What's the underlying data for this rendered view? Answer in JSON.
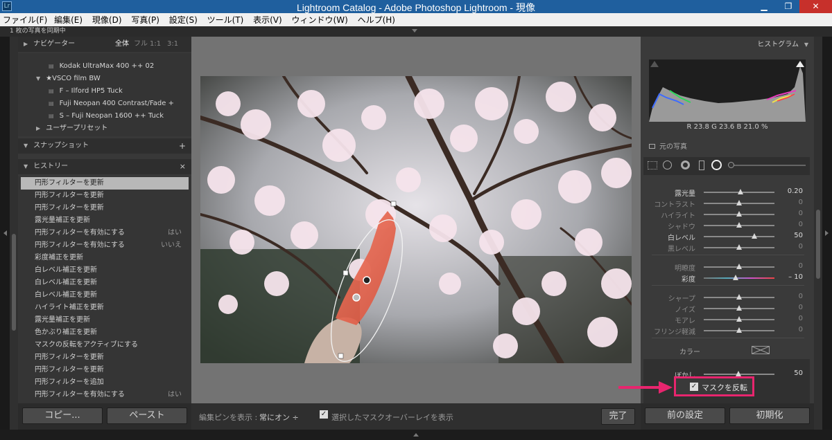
{
  "titlebar": {
    "title": "Lightroom Catalog - Adobe Photoshop Lightroom - 現像",
    "app_icon": "Lr",
    "minimize": "▁",
    "maximize": "❐",
    "close": "✕"
  },
  "menubar": {
    "items": [
      "ファイル(F)",
      "編集(E)",
      "現像(D)",
      "写真(P)",
      "設定(S)",
      "ツール(T)",
      "表示(V)",
      "ウィンドウ(W)",
      "ヘルプ(H)"
    ]
  },
  "status": "1 枚の写真を同期中",
  "navigator": {
    "title": "ナビゲーター",
    "zoom_options": [
      "全体",
      "フル",
      "1:1",
      "3:1"
    ]
  },
  "presets": {
    "items": [
      {
        "label": "Kodak UltraMax 400 ++ 02"
      },
      {
        "label": "★VSCO film BW"
      },
      {
        "label": "F – Ilford HP5 Tuck"
      },
      {
        "label": "Fuji Neopan 400 Contrast/Fade +"
      },
      {
        "label": "S – Fuji Neopan 1600 ++ Tuck"
      },
      {
        "label": "ユーザープリセット"
      }
    ]
  },
  "snapshot": {
    "title": "スナップショット",
    "add": "+"
  },
  "history": {
    "title": "ヒストリー",
    "clear": "×",
    "items": [
      {
        "label": "円形フィルターを更新",
        "side": ""
      },
      {
        "label": "円形フィルターを更新",
        "side": ""
      },
      {
        "label": "円形フィルターを更新",
        "side": ""
      },
      {
        "label": "露光量補正を更新",
        "side": ""
      },
      {
        "label": "円形フィルターを有効にする",
        "side": "はい"
      },
      {
        "label": "円形フィルターを有効にする",
        "side": "いいえ"
      },
      {
        "label": "彩度補正を更新",
        "side": ""
      },
      {
        "label": "白レベル補正を更新",
        "side": ""
      },
      {
        "label": "白レベル補正を更新",
        "side": ""
      },
      {
        "label": "白レベル補正を更新",
        "side": ""
      },
      {
        "label": "ハイライト補正を更新",
        "side": ""
      },
      {
        "label": "露光量補正を更新",
        "side": ""
      },
      {
        "label": "色かぶり補正を更新",
        "side": ""
      },
      {
        "label": "マスクの反転をアクティブにする",
        "side": ""
      },
      {
        "label": "円形フィルターを更新",
        "side": ""
      },
      {
        "label": "円形フィルターを更新",
        "side": ""
      },
      {
        "label": "円形フィルターを追加",
        "side": ""
      },
      {
        "label": "円形フィルターを有効にする",
        "side": "はい"
      }
    ]
  },
  "left_buttons": {
    "copy": "コピー...",
    "paste": "ペースト"
  },
  "toolbar": {
    "show_pins": "編集ピンを表示 :",
    "pins_mode": "常にオン ÷",
    "overlay_check": "✓",
    "overlay_label": "選択したマスクオーバーレイを表示",
    "done": "完了"
  },
  "histogram": {
    "title": "ヒストグラム",
    "readout": "R  23.8   G  23.6   B  21.0 %",
    "original_photo": "元の写真"
  },
  "sliders": [
    {
      "label": "露光量",
      "value": "0.20",
      "pos": 0.52,
      "dim": false
    },
    {
      "label": "コントラスト",
      "value": "0",
      "pos": 0.5,
      "dim": true
    },
    {
      "label": "ハイライト",
      "value": "0",
      "pos": 0.5,
      "dim": true
    },
    {
      "label": "シャドウ",
      "value": "0",
      "pos": 0.5,
      "dim": true
    },
    {
      "label": "白レベル",
      "value": "50",
      "pos": 0.72,
      "dim": false
    },
    {
      "label": "黒レベル",
      "value": "0",
      "pos": 0.5,
      "dim": true
    },
    {
      "label": "明瞭度",
      "value": "0",
      "pos": 0.5,
      "dim": true
    },
    {
      "label": "彩度",
      "value": "– 10",
      "pos": 0.45,
      "dim": false
    },
    {
      "label": "シャープ",
      "value": "0",
      "pos": 0.5,
      "dim": true
    },
    {
      "label": "ノイズ",
      "value": "0",
      "pos": 0.5,
      "dim": true
    },
    {
      "label": "モアレ",
      "value": "0",
      "pos": 0.5,
      "dim": true
    },
    {
      "label": "フリンジ軽減",
      "value": "0",
      "pos": 0.5,
      "dim": true
    }
  ],
  "color_label": "カラー",
  "feather": {
    "label": "ぼかし",
    "value": "50"
  },
  "invert_mask": {
    "check": "✓",
    "label": "マスクを反転"
  },
  "right_buttons": {
    "previous": "前の設定",
    "reset": "初期化"
  },
  "colors": {
    "highlight": "#e8256e",
    "titlebar": "#1f5f9e"
  }
}
